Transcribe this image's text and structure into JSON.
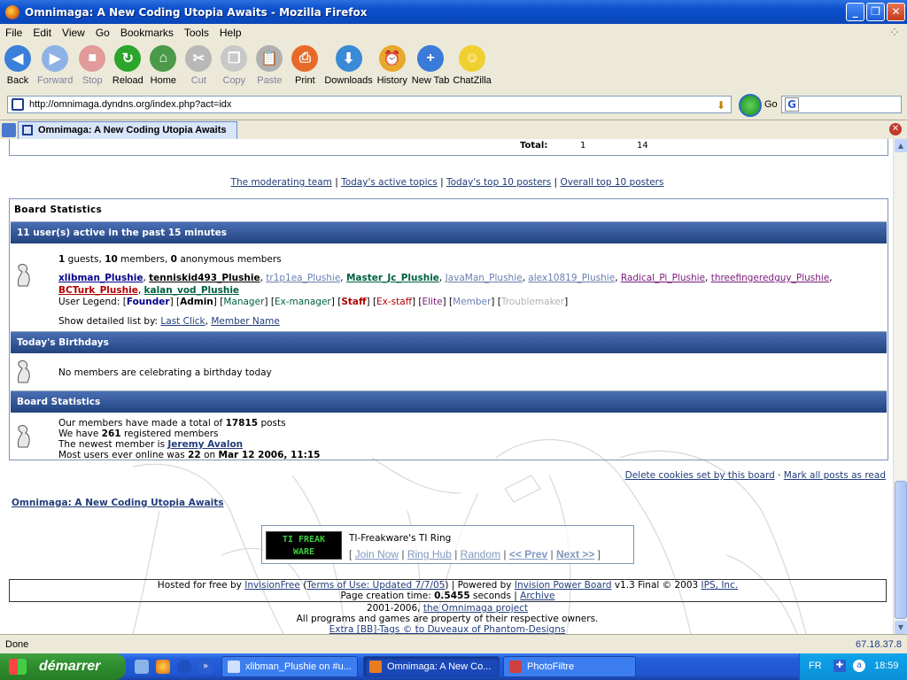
{
  "window": {
    "title": "Omnimaga: A New Coding Utopia Awaits - Mozilla Firefox"
  },
  "menu": [
    "File",
    "Edit",
    "View",
    "Go",
    "Bookmarks",
    "Tools",
    "Help"
  ],
  "toolbar": [
    {
      "label": "Back",
      "icon": "back-icon",
      "enabled": true,
      "color": "#3a7fd8"
    },
    {
      "label": "Forward",
      "icon": "forward-icon",
      "enabled": false,
      "color": "#8fb2e6"
    },
    {
      "label": "Stop",
      "icon": "stop-icon",
      "enabled": false,
      "color": "#e29a9a"
    },
    {
      "label": "Reload",
      "icon": "reload-icon",
      "enabled": true,
      "color": "#2ba52b"
    },
    {
      "label": "Home",
      "icon": "home-icon",
      "enabled": true,
      "color": "#4a9a4a"
    },
    {
      "label": "Cut",
      "icon": "cut-icon",
      "enabled": false,
      "color": "#b8b8b8"
    },
    {
      "label": "Copy",
      "icon": "copy-icon",
      "enabled": false,
      "color": "#c8c8c8"
    },
    {
      "label": "Paste",
      "icon": "paste-icon",
      "enabled": false,
      "color": "#b0b0b0"
    },
    {
      "label": "Print",
      "icon": "print-icon",
      "enabled": true,
      "color": "#e86a2a"
    },
    {
      "label": "Downloads",
      "icon": "downloads-icon",
      "enabled": true,
      "color": "#3a8ad8"
    },
    {
      "label": "History",
      "icon": "history-icon",
      "enabled": true,
      "color": "#e8a82a"
    },
    {
      "label": "New Tab",
      "icon": "new-tab-icon",
      "enabled": true,
      "color": "#3a7ad8"
    },
    {
      "label": "ChatZilla",
      "icon": "chatzilla-icon",
      "enabled": true,
      "color": "#f0d030"
    }
  ],
  "url": "http://omnimaga.dyndns.org/index.php?act=idx",
  "go_label": "Go",
  "tab": {
    "title": "Omnimaga: A New Coding Utopia Awaits"
  },
  "page": {
    "total_row": {
      "label": "Total:",
      "a": "1",
      "b": "14"
    },
    "links": [
      "The moderating team",
      "Today's active topics",
      "Today's top 10 posters",
      "Overall top 10 posters"
    ],
    "stats_caption": "Board Statistics",
    "active_header": "11 user(s) active in the past 15 minutes",
    "active_counts": {
      "guests": "1",
      "guests_label": "guests,",
      "members": "10",
      "members_label": "members,",
      "anon": "0",
      "anon_label": "anonymous members"
    },
    "users": [
      {
        "name": "xlibman_Plushie",
        "color": "#00008b"
      },
      {
        "name": "tenniskid493_Plushie",
        "color": "#000000"
      },
      {
        "name": "tr1p1ea_Plushie",
        "color": "#6a7fb0",
        "plain": true
      },
      {
        "name": "Master_Jc_Plushie",
        "color": "#006040"
      },
      {
        "name": "JavaMan_Plushie",
        "color": "#6a7fb0",
        "plain": true
      },
      {
        "name": "alex10819_Plushie",
        "color": "#6a7fb0",
        "plain": true
      },
      {
        "name": "Radical_Pi_Plushie",
        "color": "#7a1a7a",
        "plain": true
      },
      {
        "name": "threefingeredguy_Plushie",
        "color": "#7a1a7a",
        "plain": true
      },
      {
        "name": "BCTurk_Plushie",
        "color": "#b00000"
      },
      {
        "name": "kalan_vod_Plushie",
        "color": "#006040"
      }
    ],
    "legend_label": "User Legend:",
    "legend": [
      {
        "name": "Founder",
        "color": "#00008b",
        "bold": true
      },
      {
        "name": "Admin",
        "color": "#000000",
        "bold": true
      },
      {
        "name": "Manager",
        "color": "#006040",
        "bold": false
      },
      {
        "name": "Ex-manager",
        "color": "#006040",
        "bold": false
      },
      {
        "name": "Staff",
        "color": "#b00000",
        "bold": true
      },
      {
        "name": "Ex-staff",
        "color": "#b00000",
        "bold": false
      },
      {
        "name": "Elite",
        "color": "#7a1a7a",
        "bold": false
      },
      {
        "name": "Member",
        "color": "#6a7fb0",
        "bold": false
      },
      {
        "name": "Troublemaker",
        "color": "#b0b0b0",
        "bold": false
      }
    ],
    "show_list_label": "Show detailed list by:",
    "show_list_links": [
      "Last Click",
      "Member Name"
    ],
    "birthdays_header": "Today's Birthdays",
    "birthdays_text": "No members are celebrating a birthday today",
    "stats_header": "Board Statistics",
    "stats": {
      "posts_prefix": "Our members have made a total of",
      "posts": "17815",
      "posts_suffix": "posts",
      "reg_prefix": "We have",
      "reg": "261",
      "reg_suffix": "registered members",
      "newest_prefix": "The newest member is",
      "newest": "Jeremy Avalon",
      "most_prefix": "Most users ever online was",
      "most": "22",
      "most_on": "on",
      "most_date": "Mar 12 2006, 11:15"
    },
    "foot_links": [
      "Delete cookies set by this board",
      "Mark all posts as read"
    ],
    "forum_title": "Omnimaga: A New Coding Utopia Awaits",
    "ring": {
      "logo": [
        "TI FREAK",
        "WARE"
      ],
      "title": "TI-Freakware's TI Ring",
      "nav": [
        "Join Now",
        "Ring Hub",
        "Random",
        "<< Prev",
        "Next >>"
      ]
    },
    "hosted": {
      "prefix": "Hosted for free by",
      "invisionfree": "InvisionFree",
      "terms": "Terms of Use: Updated 7/7/05",
      "powered": "Powered by",
      "ipb": "Invision Power Board",
      "ver": "v1.3 Final © 2003",
      "ips": "IPS, Inc.",
      "ptime_prefix": "Page creation time:",
      "ptime": "0.5455",
      "ptime_suffix": "seconds",
      "archive": "Archive"
    },
    "copyright": {
      "years": "2001-2006,",
      "project": "the Omnimaga project",
      "rights": "All programs and games are property of their respective owners.",
      "extra": "Extra [BB]-Tags © to Duveaux of Phantom-Designs"
    }
  },
  "status": {
    "text": "Done",
    "ip": "67.18.37.8"
  },
  "taskbar": {
    "start": "démarrer",
    "tasks": [
      {
        "label": "xlibman_Plushie on #u...",
        "color": "#d0e0ff"
      },
      {
        "label": "Omnimaga: A New Co...",
        "color": "#e87a20",
        "active": true
      },
      {
        "label": "PhotoFiltre",
        "color": "#d04040"
      }
    ],
    "lang": "FR",
    "clock": "18:59"
  }
}
